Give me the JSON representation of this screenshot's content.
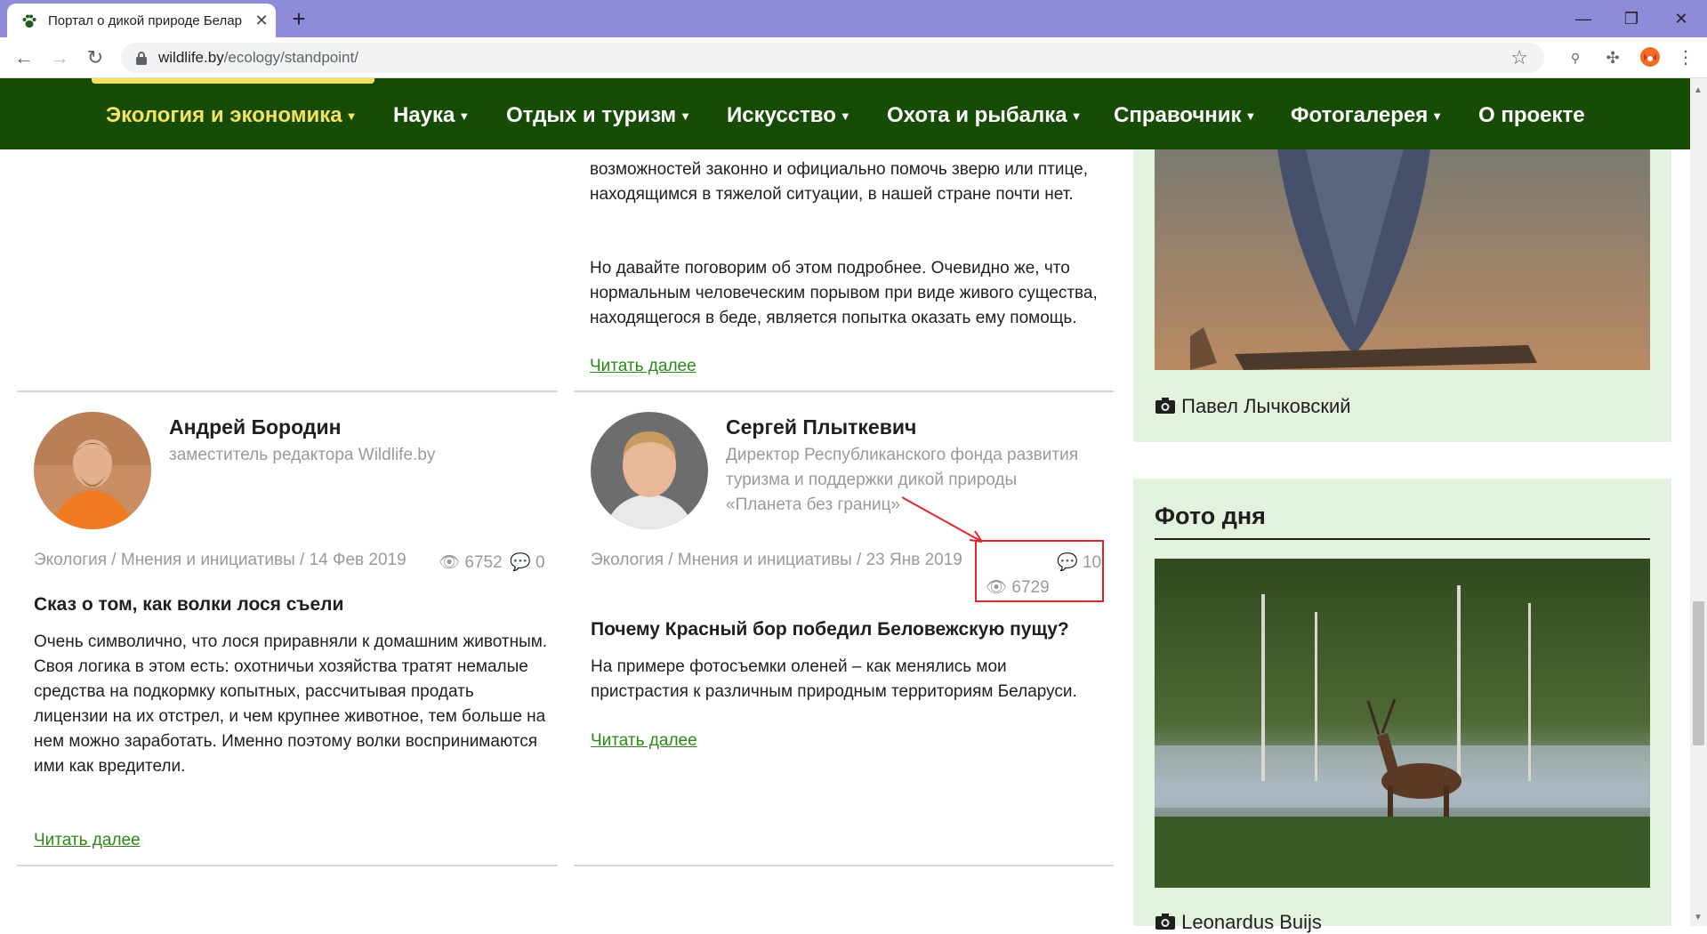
{
  "browser": {
    "tab_title": "Портал о дикой природе Белар",
    "url_domain": "wildlife.by",
    "url_path": "/ecology/standpoint/"
  },
  "nav": {
    "items": [
      {
        "label": "Экология и экономика",
        "active": true
      },
      {
        "label": "Наука"
      },
      {
        "label": "Отдых и туризм"
      },
      {
        "label": "Искусство"
      },
      {
        "label": "Охота и рыбалка"
      },
      {
        "label": "Справочник"
      },
      {
        "label": "Фотогалерея"
      },
      {
        "label": "О проекте"
      }
    ],
    "active_color": "#f5e25f",
    "background": "#164c06"
  },
  "top_article": {
    "text1": "возможностей законно и официально помочь зверю или птице, находящимся в тяжелой ситуации, в нашей стране почти нет.",
    "text2": "Но давайте поговорим об этом подробнее. Очевидно же, что нормальным человеческим порывом при виде живого существа, находящегося в беде, является попытка оказать ему помощь.",
    "read_more": "Читать далее"
  },
  "articles": [
    {
      "author": "Андрей Бородин",
      "role": "заместитель редактора Wildlife.by",
      "meta": "Экология / Мнения и инициативы / 14 Фев 2019",
      "views": "6752",
      "comments": "0",
      "title": "Сказ о том, как волки лося съели",
      "text": "Очень символично, что лося приравняли к домашним животным. Своя логика в этом есть: охотничьи хозяйства тратят немалые средства на подкормку копытных, рассчитывая продать лицензии на их отстрел, и чем крупнее животное, тем больше на нем можно заработать. Именно поэтому волки воспринимаются ими как вредители.",
      "read_more": "Читать далее"
    },
    {
      "author": "Сергей Плыткевич",
      "role": "Директор Республиканского фонда развития туризма и поддержки дикой природы «Планета без границ»",
      "meta": "Экология / Мнения и инициативы / 23 Янв 2019",
      "views": "6729",
      "comments": "10",
      "title": "Почему Красный бор победил Беловежскую пущу?",
      "text": "На примере фотосъемки оленей – как менялись мои пристрастия к различным природным территориям Беларуси.",
      "read_more": "Читать далее"
    }
  ],
  "sidebar": {
    "photo1_caption": "Павел Лычковский",
    "widget_title": "Фото дня",
    "photo2_caption": "Leonardus Buijs"
  },
  "colors": {
    "accent_green": "#2b8a17",
    "panel_bg": "#e3f2dd",
    "annotation_red": "#e0262b"
  }
}
